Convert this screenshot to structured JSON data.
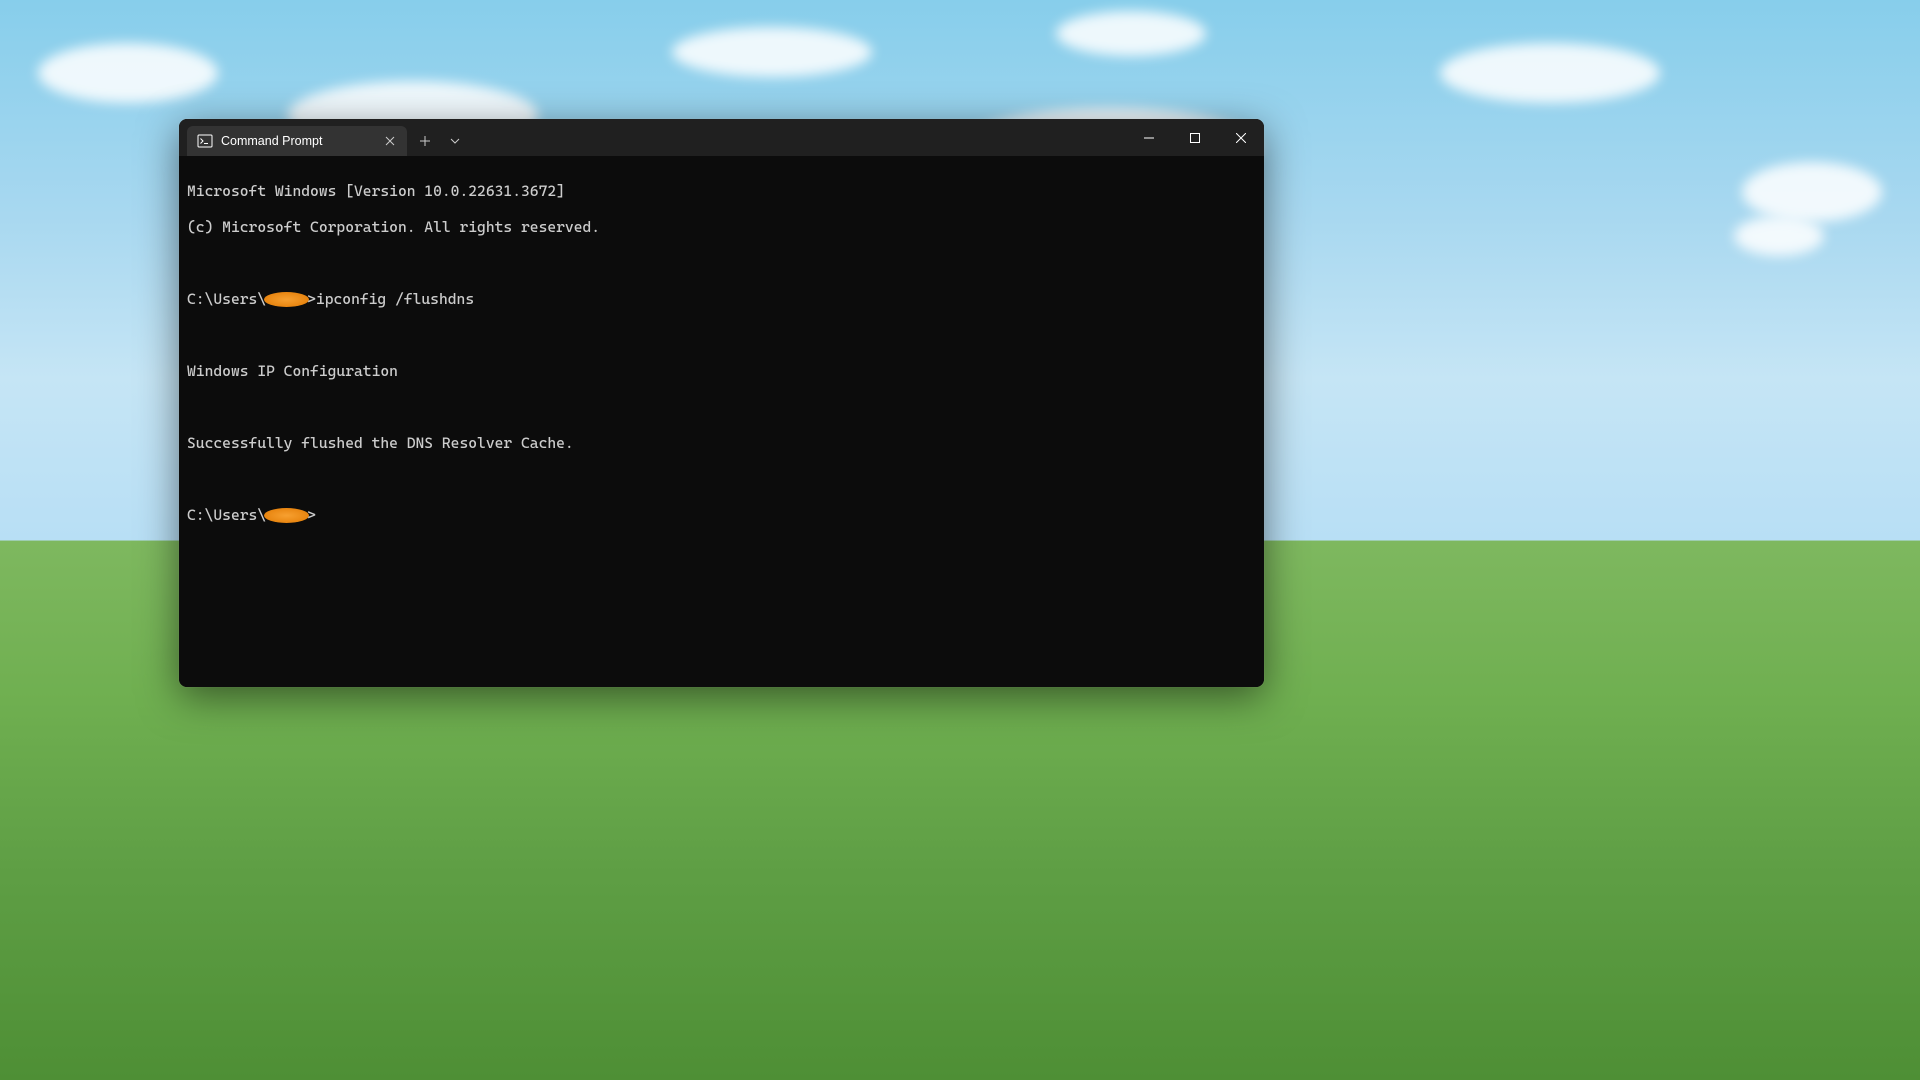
{
  "tab": {
    "title": "Command Prompt"
  },
  "terminal": {
    "line1": "Microsoft Windows [Version 10.0.22631.3672]",
    "line2": "(c) Microsoft Corporation. All rights reserved.",
    "prompt1_prefix": "C:\\Users\\",
    "prompt1_suffix": ">",
    "command1": "ipconfig /flushdns",
    "output_header": "Windows IP Configuration",
    "output_result": "Successfully flushed the DNS Resolver Cache.",
    "prompt2_prefix": "C:\\Users\\",
    "prompt2_suffix": ">"
  }
}
